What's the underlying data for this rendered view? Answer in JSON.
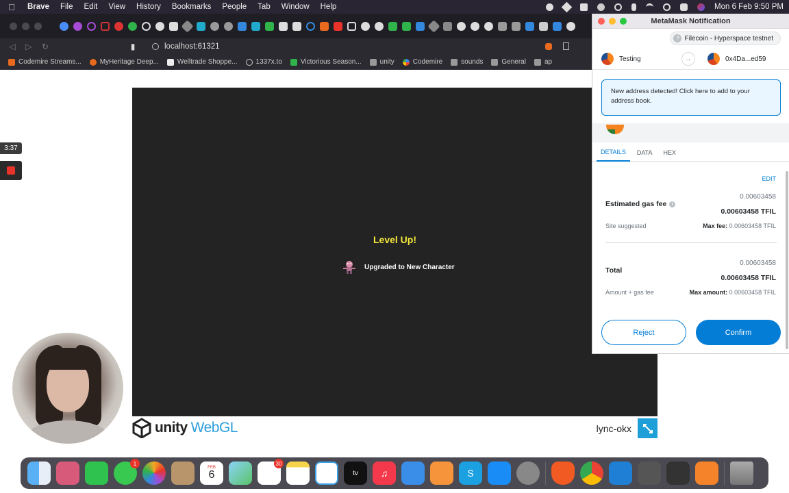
{
  "menubar": {
    "app": "Brave",
    "items": [
      "File",
      "Edit",
      "View",
      "History",
      "Bookmarks",
      "People",
      "Tab",
      "Window",
      "Help"
    ],
    "clock": "Mon 6 Feb  9:50 PM"
  },
  "browser": {
    "url": "localhost:61321",
    "bookmarks": [
      "Codemire Streams...",
      "MyHeritage Deep...",
      "Welltrade Shoppe...",
      "1337x.to",
      "Victorious Season...",
      "unity",
      "Codemire",
      "sounds",
      "General",
      "ap"
    ]
  },
  "recording": {
    "time": "3:37"
  },
  "game": {
    "level_up": "Level Up!",
    "upgraded": "Upgraded to New Character",
    "unity_word": "unity",
    "webgl_word": "WebGL",
    "title": "lync-okx"
  },
  "metamask": {
    "window_title": "MetaMask Notification",
    "network": "Filecoin - Hyperspace testnet",
    "from_account": "Testing",
    "to_account": "0x4Da...ed59",
    "alert": "New address detected! Click here to add to your address book.",
    "tabs": [
      "DETAILS",
      "DATA",
      "HEX"
    ],
    "edit": "EDIT",
    "gas": {
      "label": "Estimated gas fee",
      "value": "0.00603458",
      "value_bold": "0.00603458 TFIL",
      "sub": "Site suggested",
      "max_label": "Max fee:",
      "max_value": "0.00603458 TFIL"
    },
    "total": {
      "label": "Total",
      "value": "0.00603458",
      "value_bold": "0.00603458 TFIL",
      "sub": "Amount + gas fee",
      "max_label": "Max amount:",
      "max_value": "0.00603458 TFIL"
    },
    "reject": "Reject",
    "confirm": "Confirm"
  },
  "dock": {
    "calendar_month": "FEB",
    "calendar_day": "6",
    "messages_badge": "1",
    "reminders_badge": "30",
    "apps": [
      "finder-icon",
      "launchpad-icon",
      "facetime-icon",
      "messages-icon",
      "photos-icon",
      "contacts-icon",
      "calendar-icon",
      "maps-icon",
      "reminders-icon",
      "notes-icon",
      "freeform-icon",
      "appletv-icon",
      "music-icon",
      "keynote-icon",
      "pages-icon",
      "skype-icon",
      "appstore-icon",
      "settings-icon",
      "brave-icon",
      "chrome-icon",
      "vscode-icon",
      "unity-icon",
      "unity-hub-icon",
      "sublime-icon",
      "trash-icon"
    ]
  }
}
